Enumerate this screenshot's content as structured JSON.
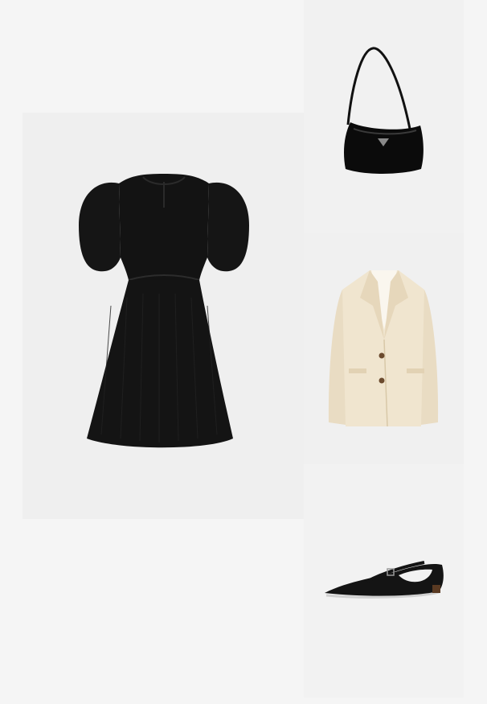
{
  "products": [
    {
      "id": "dress",
      "name": "",
      "icon": "dress-image"
    },
    {
      "id": "bag",
      "name": "",
      "icon": "shoulder-bag-image"
    },
    {
      "id": "blazer",
      "name": "",
      "icon": "blazer-image"
    },
    {
      "id": "shoe",
      "name": "",
      "icon": "flat-shoe-image"
    }
  ],
  "colors": {
    "page_background": "#f5f5f5",
    "tile_background": "#efefef",
    "dress": "#141414",
    "bag": "#0c0c0c",
    "blazer": "#efe3cc",
    "shoe": "#161616"
  }
}
